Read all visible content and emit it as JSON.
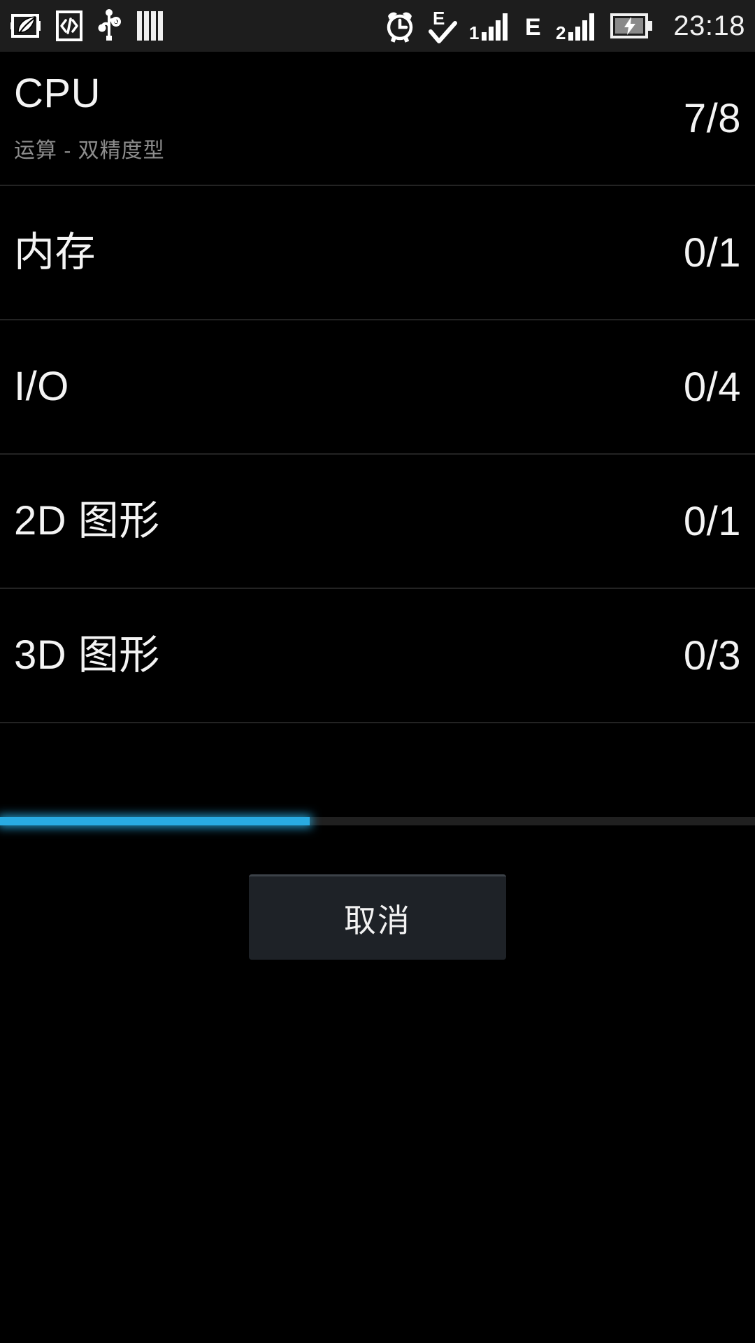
{
  "statusbar": {
    "time": "23:18",
    "left_icons": [
      {
        "name": "power-saving-leaf-icon",
        "label": "省电模式"
      },
      {
        "name": "developer-code-icon",
        "label": "开发者选项"
      },
      {
        "name": "usb-icon",
        "label": "USB"
      },
      {
        "name": "equalizer-bars-icon",
        "label": "音效"
      }
    ],
    "right_icons": [
      {
        "name": "alarm-clock-icon",
        "label": "闹钟"
      },
      {
        "name": "edge-sync-check-icon",
        "label": "E"
      },
      {
        "name": "sim1-signal-icon",
        "label": "1"
      },
      {
        "name": "edge-network-icon",
        "label": "E"
      },
      {
        "name": "sim2-signal-icon",
        "label": "2"
      },
      {
        "name": "battery-charging-icon",
        "label": "充电中"
      }
    ],
    "sim1_label": "1",
    "sim2_label": "2",
    "edge_label": "E",
    "sim1_bars": 5,
    "sim2_bars": 4
  },
  "benchmark": {
    "rows": [
      {
        "title": "CPU",
        "subtitle": "运算 - 双精度型",
        "count": "7/8"
      },
      {
        "title": "内存",
        "subtitle": "",
        "count": "0/1"
      },
      {
        "title": "I/O",
        "subtitle": "",
        "count": "0/4"
      },
      {
        "title": "2D 图形",
        "subtitle": "",
        "count": "0/1"
      },
      {
        "title": "3D 图形",
        "subtitle": "",
        "count": "0/3"
      }
    ]
  },
  "progress": {
    "percent": 41,
    "fill_color": "#29abe2",
    "track_color": "#202020"
  },
  "actions": {
    "cancel_label": "取消"
  }
}
